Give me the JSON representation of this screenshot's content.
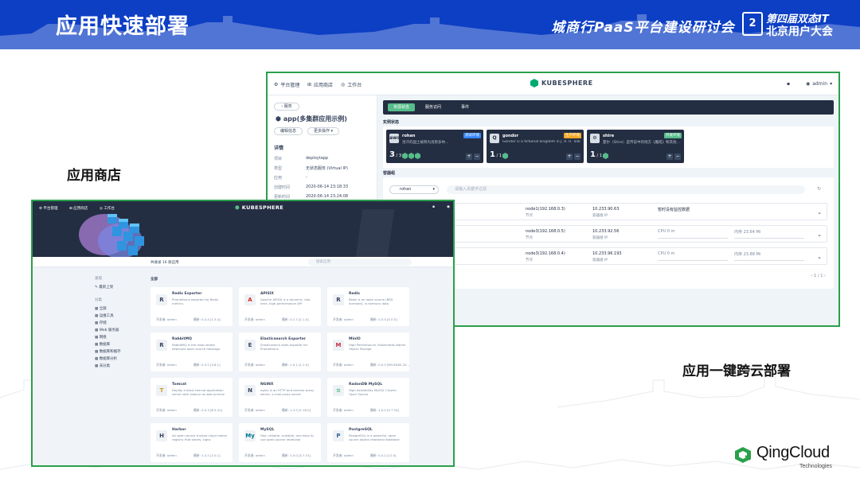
{
  "slide": {
    "title": "应用快速部署",
    "conference": "城商行PaaS平台建设研讨会",
    "event_logo": "2",
    "event_line1": "第四届双态IT",
    "event_line2": "北京用户大会",
    "caption_store": "应用商店",
    "caption_multicloud": "应用一键跨云部署",
    "brand_name": "QingCloud",
    "brand_sub": "Technologies",
    "brand_color": "#2aa04b",
    "header_color": "#0d3fc4"
  },
  "console": {
    "nav": [
      "平台管理",
      "应用商店",
      "工作台"
    ],
    "brand": "KUBESPHERE",
    "user": "admin",
    "back_label": "服务",
    "app_title": "app(多集群应用示例)",
    "edit_btn": "编辑信息",
    "more_btn": "更多操作",
    "detail_heading": "详情",
    "details": [
      {
        "k": "项目",
        "v": "deploytapp"
      },
      {
        "k": "类型",
        "v": "无状态服务 (Virtual IP)"
      },
      {
        "k": "应用",
        "v": "-"
      },
      {
        "k": "创建时间",
        "v": "2020-06-14 23:18:33"
      },
      {
        "k": "更新时间",
        "v": "2020-06-14 23:24:08"
      }
    ],
    "tabs": [
      "资源状态",
      "服务访问",
      "事件"
    ],
    "instance_section": "实例状态",
    "instances": [
      {
        "icon": "aws",
        "name": "rohan",
        "tag": "测试环境",
        "tag_color": "#3385ff",
        "desc": "洛汗的国土被称为洛斯多林…",
        "ready": "3",
        "total": "3",
        "cubes": 3
      },
      {
        "icon": "Q",
        "name": "gondor",
        "tag": "生产环境",
        "tag_color": "#f5a623",
        "desc": "Gondor is a fictional kingdom in J. R. R. Tolkien…",
        "ready": "1",
        "total": "1",
        "cubes": 1
      },
      {
        "icon": "⚙",
        "name": "shire",
        "tag": "开发环境",
        "tag_color": "#55bc8a",
        "desc": "夏尔（Shire）是传说中的地方《魔戒》和其他…",
        "ready": "1",
        "total": "1",
        "cubes": 1
      }
    ],
    "group_section": "容器组",
    "cluster_select": "rohan",
    "search_placeholder": "请输入关键字过滤",
    "rows": [
      {
        "name": "…",
        "node": "node1(192.168.0.3)",
        "node_sub": "节点",
        "ip": "10.233.90.63",
        "ip_sub": "容器组 IP",
        "cpu": "暂时没有监控数据",
        "mem": ""
      },
      {
        "name": "…",
        "node": "node3(192.168.0.5)",
        "node_sub": "节点",
        "ip": "10.233.92.56",
        "ip_sub": "容器组 IP",
        "cpu": "CPU 0 m",
        "mem": "内存 23.64 Mi"
      },
      {
        "name": "…",
        "node": "node3(192.168.0.4)",
        "node_sub": "节点",
        "ip": "10.233.96.193",
        "ip_sub": "容器组 IP",
        "cpu": "CPU 0 m",
        "mem": "内存 23.88 Mi"
      }
    ],
    "pager": "1 / 1"
  },
  "store": {
    "nav": [
      "平台管理",
      "应用商店",
      "工作台"
    ],
    "brand": "KUBESPHERE",
    "count_label": "共收录 16 款应用",
    "search_placeholder": "搜索应用",
    "side_groups": [
      {
        "label": "发现",
        "items": [
          "最新上架"
        ]
      },
      {
        "label": "分类",
        "items": [
          "全部",
          "运维工具",
          "存储",
          "Web 服务器",
          "网络",
          "数据库",
          "数据库和缓存",
          "数据库分析",
          "未分类"
        ]
      }
    ],
    "list_heading": "全部",
    "cards": [
      {
        "icon": "R",
        "icon_color": "#36435c",
        "name": "Redis Exporter",
        "desc": "Prometheus exporter for Redis metrics",
        "dev": "开发者: admin",
        "ver": "最新: 0.4.4 [1.3.4]"
      },
      {
        "icon": "A",
        "icon_color": "#d9281c",
        "name": "APISIX",
        "desc": "Apache APISIX is a dynamic, real-time, high-performance API",
        "dev": "开发者: admin",
        "ver": "最新: 0.1.7 [1.1.0]"
      },
      {
        "icon": "R",
        "icon_color": "#36435c",
        "name": "Redis",
        "desc": "Redis is an open source (BSD licensed), in-memory data",
        "dev": "开发者: admin",
        "ver": "最新: 0.3.5 [5.0.5]"
      },
      {
        "icon": "R",
        "icon_color": "#36435c",
        "name": "RabbitMQ",
        "desc": "RabbitMQ is the most widely deployed open source message",
        "dev": "开发者: admin",
        "ver": "最新: 0.3.2 [3.8.1]"
      },
      {
        "icon": "E",
        "icon_color": "#36435c",
        "name": "Elasticsearch Exporter",
        "desc": "Elasticsearch stats exporter for Prometheus",
        "dev": "开发者: admin",
        "ver": "最新: 1.0.1 [1.1.0]"
      },
      {
        "icon": "M",
        "icon_color": "#c72c48",
        "name": "MinIO",
        "desc": "High Performance, Kubernetes Native Object Storage",
        "dev": "开发者: admin",
        "ver": "最新: 0.0.5 [RELEASE.20…"
      },
      {
        "icon": "T",
        "icon_color": "#d19a18",
        "name": "Tomcat",
        "desc": "Deploy a basic tomcat application server with sidecar as web archive",
        "dev": "开发者: admin",
        "ver": "最新: 0.4.3 [8.5.41]"
      },
      {
        "icon": "N",
        "icon_color": "#36435c",
        "name": "NGINX",
        "desc": "nginx is an HTTP and reverse proxy server, a mail proxy server",
        "dev": "开发者: admin",
        "ver": "最新: 1.3.3 [1.16.0]"
      },
      {
        "icon": "≋",
        "icon_color": "#55bc8a",
        "name": "RadonDB MySQL",
        "desc": "High Availability MySQL Cluster, Open Source",
        "dev": "开发者: admin",
        "ver": "最新: 1.0.0 [5.7.34]"
      },
      {
        "icon": "H",
        "icon_color": "#36435c",
        "name": "Harbor",
        "desc": "An open source trusted cloud native registry that stores, signs",
        "dev": "开发者: admin",
        "ver": "最新: 1.4.1 [2.0.1]"
      },
      {
        "icon": "My",
        "icon_color": "#00758f",
        "name": "MySQL",
        "desc": "Fast, reliable, scalable, and easy to use open-source relational",
        "dev": "开发者: admin",
        "ver": "最新: 1.0.0 [5.7.31]"
      },
      {
        "icon": "P",
        "icon_color": "#336791",
        "name": "PostgreSQL",
        "desc": "PostgreSQL is a powerful, open source object-relational database",
        "dev": "开发者: admin",
        "ver": "最新: 0.4.2 [12.0]"
      }
    ]
  }
}
